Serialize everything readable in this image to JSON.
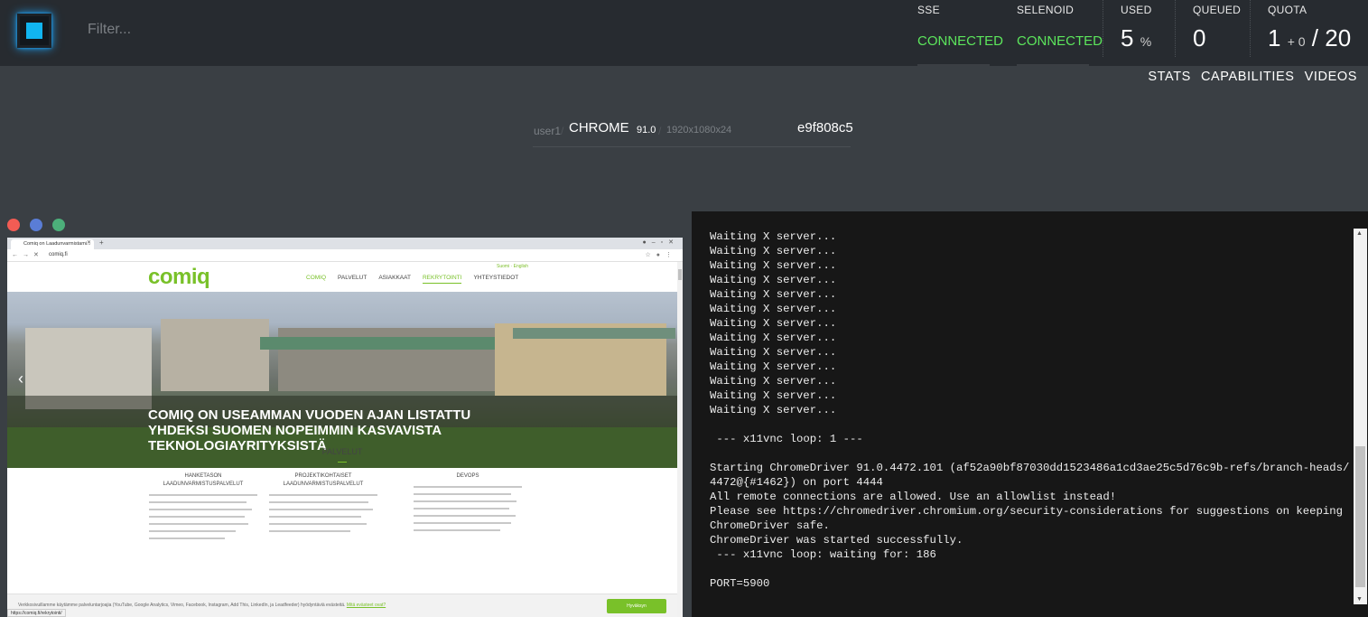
{
  "header": {
    "filter_placeholder": "Filter...",
    "stats": [
      {
        "label": "SSE",
        "value": "CONNECTED"
      },
      {
        "label": "SELENOID",
        "value": "CONNECTED"
      }
    ],
    "used": {
      "label": "USED",
      "value": "5",
      "unit": "%"
    },
    "queued": {
      "label": "QUEUED",
      "value": "0"
    },
    "quota": {
      "label": "QUOTA",
      "used": "1",
      "pending": "+ 0",
      "total": "/ 20"
    },
    "status_color": "#5ce65c"
  },
  "nav": {
    "stats": "STATS",
    "capabilities": "CAPABILITIES",
    "videos": "VIDEOS"
  },
  "session": {
    "user": "user1",
    "sep": "/",
    "browser": "CHROME",
    "version": "91.0",
    "resolution": "1920x1080x24",
    "id": "e9f808c5"
  },
  "vnc": {
    "window_dots": [
      "#f25c54",
      "#5a7dd6",
      "#4caf7a"
    ],
    "browser": {
      "tab_title": "Comiq on Laadunvarmistami...",
      "url": "comiq.fi",
      "status_url": "https://comiq.fi/rekrytointi/"
    },
    "site": {
      "lang": "Suomi · English",
      "logo": "comiq",
      "nav": [
        "COMIQ",
        "PALVELUT",
        "ASIAKKAAT",
        "REKRYTOINTI",
        "YHTEYSTIEDOT"
      ],
      "hero_text": "COMIQ ON USEAMMAN VUODEN AJAN LISTATTU YHDEKSI SUOMEN NOPEIMMIN KASVAVISTA TEKNOLOGIAYRITYKSISTÄ",
      "section_title": "PALVELUT",
      "columns": [
        {
          "title": "HANKETASON LAADUNVARMISTUSPALVELUT"
        },
        {
          "title": "PROJEKTIKOHTAISET LAADUNVARMISTUSPALVELUT"
        },
        {
          "title": "DEVOPS"
        }
      ],
      "cookie_text": "Verkkosivuillamme käytämme palveluntarjoajia (YouTube, Google Analytics, Vimeo, Facebook, Instagram, Add This, LinkedIn, ja Leadfeeder) hyödyntäviä evästeitä.",
      "cookie_link": "Mitä evästeet ovat?",
      "cookie_button": "Hyväksyn"
    }
  },
  "log": {
    "lines": [
      "Waiting X server...",
      "Waiting X server...",
      "Waiting X server...",
      "Waiting X server...",
      "Waiting X server...",
      "Waiting X server...",
      "Waiting X server...",
      "Waiting X server...",
      "Waiting X server...",
      "Waiting X server...",
      "Waiting X server...",
      "Waiting X server...",
      "Waiting X server...",
      "",
      " --- x11vnc loop: 1 ---",
      "",
      "Starting ChromeDriver 91.0.4472.101 (af52a90bf87030dd1523486a1cd3ae25c5d76c9b-refs/branch-heads/4472@{#1462}) on port 4444",
      "All remote connections are allowed. Use an allowlist instead!",
      "Please see https://chromedriver.chromium.org/security-considerations for suggestions on keeping ChromeDriver safe.",
      "ChromeDriver was started successfully.",
      " --- x11vnc loop: waiting for: 186",
      "",
      "PORT=5900"
    ]
  }
}
